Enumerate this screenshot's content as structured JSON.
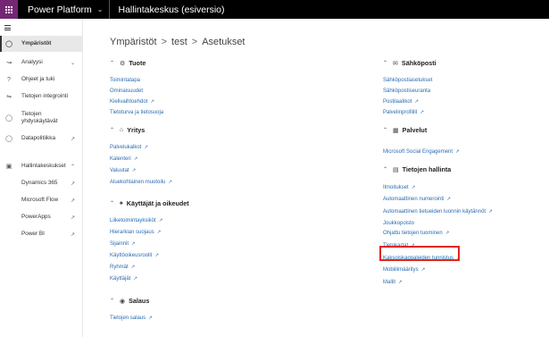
{
  "topbar": {
    "app_name": "Power Platform",
    "environment": "Hallintakeskus (esiversio)"
  },
  "sidebar": {
    "items": [
      {
        "label": "Ympäristöt",
        "icon": "globe-icon"
      },
      {
        "label": "Analyysi",
        "icon": "chart-icon"
      },
      {
        "label": "Ohjeet ja tuki",
        "icon": "help-icon"
      },
      {
        "label": "Tietojen integrointi",
        "icon": "integration-icon"
      },
      {
        "label": "Tietojen yhdyskäytävät",
        "icon": "gateway-icon"
      },
      {
        "label": "Datapolitiikka",
        "icon": "shield-icon"
      },
      {
        "label": "Hallintakeskukset",
        "icon": "admin-icon"
      }
    ],
    "sub_items": [
      {
        "label": "Dynamics 365"
      },
      {
        "label": "Microsoft Flow"
      },
      {
        "label": "PowerApps"
      },
      {
        "label": "Power BI"
      }
    ]
  },
  "breadcrumb": {
    "part1": "Ympäristöt",
    "part2": "test",
    "part3": "Asetukset",
    "sep": ">"
  },
  "sections_left": [
    {
      "title": "Tuote",
      "icon": "gear-icon",
      "links": [
        {
          "label": "Toimintatapa",
          "external": false
        },
        {
          "label": "Ominaisuudet",
          "external": false
        },
        {
          "label": "Kielivaihtoehdot",
          "external": true
        },
        {
          "label": "Tietoturva ja tietosuoja",
          "external": false
        }
      ]
    },
    {
      "title": "Yritys",
      "icon": "building-icon",
      "links": [
        {
          "label": "Palvelukalkot",
          "external": true
        },
        {
          "label": "Kalenteri",
          "external": true
        },
        {
          "label": "Valuutat",
          "external": true
        },
        {
          "label": "Aluekohtainen muotoilu",
          "external": true
        }
      ]
    },
    {
      "title": "Käyttäjät ja oikeudet",
      "icon": "users-icon",
      "links": [
        {
          "label": "Liiketoimintayksiköt",
          "external": true
        },
        {
          "label": "Hierarkian suojaus",
          "external": true
        },
        {
          "label": "Sijainnit",
          "external": true
        },
        {
          "label": "Käyttöoikeusroolit",
          "external": true
        },
        {
          "label": "Ryhmät",
          "external": true
        },
        {
          "label": "Käyttäjät",
          "external": true
        }
      ]
    },
    {
      "title": "Salaus",
      "icon": "lock-icon",
      "links": [
        {
          "label": "Tietojen salaus",
          "external": true
        }
      ]
    }
  ],
  "sections_right": [
    {
      "title": "Sähköposti",
      "icon": "mail-icon",
      "links": [
        {
          "label": "Sähköpostiasetukset",
          "external": false
        },
        {
          "label": "Sähköpostiseuranta",
          "external": false
        },
        {
          "label": "Postilaatikot",
          "external": true
        },
        {
          "label": "Palvelinprofiilit",
          "external": true
        }
      ]
    },
    {
      "title": "Palvelut",
      "icon": "windows-icon",
      "links": [
        {
          "label": "Microsoft Social Engagement",
          "external": true
        }
      ]
    },
    {
      "title": "Tietojen hallinta",
      "icon": "data-icon",
      "links": [
        {
          "label": "Ilmoitukset",
          "external": true
        },
        {
          "label": "Automaattinen numerointi",
          "external": true
        },
        {
          "label": "Automaattinen tietueiden luonnin käytännöt",
          "external": true
        },
        {
          "label": "Ohjattu tietojen tuominen",
          "external": true
        },
        {
          "label": "Tietokartat",
          "external": true
        },
        {
          "label": "Kaksoiskappaleiden tunnistus",
          "external": true
        },
        {
          "label": "Mobiilimääritys",
          "external": true
        },
        {
          "label": "Mallit",
          "external": true
        }
      ]
    }
  ],
  "hidden_link_partial": "Joukkopoisto",
  "colors": {
    "accent_purple": "#742774",
    "link_blue": "#2b6cb0",
    "highlight_red": "#e0261c"
  }
}
